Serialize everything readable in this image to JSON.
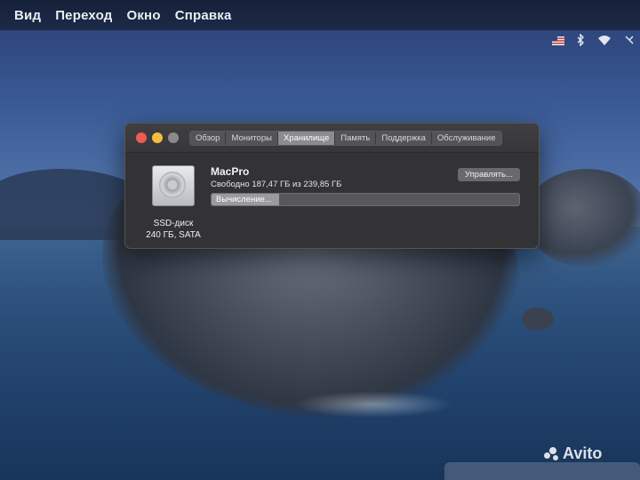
{
  "menubar": {
    "items": [
      "Вид",
      "Переход",
      "Окно",
      "Справка"
    ]
  },
  "status": {
    "flag_icon": "us-flag-icon",
    "bluetooth_icon": "bluetooth-icon",
    "wifi_icon": "wifi-icon"
  },
  "window": {
    "tabs": [
      {
        "label": "Обзор",
        "active": false
      },
      {
        "label": "Мониторы",
        "active": false
      },
      {
        "label": "Хранилище",
        "active": true
      },
      {
        "label": "Память",
        "active": false
      },
      {
        "label": "Поддержка",
        "active": false
      },
      {
        "label": "Обслуживание",
        "active": false
      }
    ],
    "disk": {
      "icon": "hard-drive-icon",
      "caption_line1": "SSD-диск",
      "caption_line2": "240 ГБ, SATA"
    },
    "volume": {
      "name": "MacPro",
      "free_space": "Свободно 187,47 ГБ из 239,85 ГБ",
      "manage_label": "Управлять...",
      "usage_label": "Вычисление...",
      "usage_fraction": 0.22
    }
  },
  "watermark": {
    "text": "Avito"
  },
  "colors": {
    "close": "#ef5b55",
    "minimize": "#f6be3f",
    "active_tab": "#8c8c90"
  }
}
